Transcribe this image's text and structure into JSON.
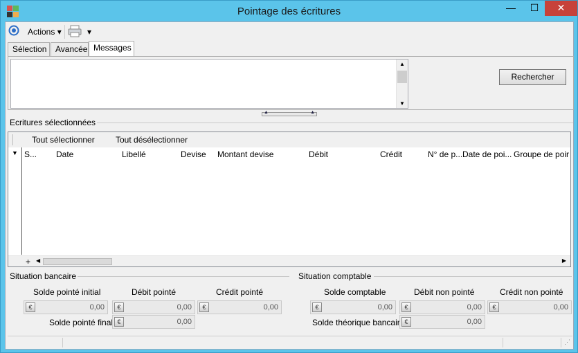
{
  "window": {
    "title": "Pointage des écritures",
    "minimize": "—",
    "maximize": "☐",
    "close": "✕"
  },
  "toolbar": {
    "actions_label": "Actions",
    "dropdown_arrow": "▾"
  },
  "tabs": [
    {
      "label": "Sélection"
    },
    {
      "label": "Avancée"
    },
    {
      "label": "Messages"
    }
  ],
  "search_button": "Rechercher",
  "grid": {
    "title": "Ecritures sélectionnées",
    "select_all": "Tout sélectionner",
    "deselect_all": "Tout désélectionner",
    "columns": [
      "S...",
      "Date",
      "Libellé",
      "Devise",
      "Montant devise",
      "Débit",
      "Crédit",
      "N° de p...",
      "Date de poi...",
      "Groupe de poir"
    ],
    "add_symbol": "+"
  },
  "situation_bancaire": {
    "title": "Situation bancaire",
    "solde_initial_label": "Solde pointé initial",
    "solde_initial_value": "0,00",
    "solde_final_label": "Solde pointé final",
    "debit_pointe_label": "Débit  pointé",
    "debit_pointe_value": "0,00",
    "solde_final_value": "0,00",
    "credit_pointe_label": "Crédit pointé",
    "credit_pointe_value": "0,00"
  },
  "situation_comptable": {
    "title": "Situation comptable",
    "solde_comptable_label": "Solde comptable",
    "solde_comptable_value": "0,00",
    "solde_theorique_label": "Solde théorique bancaire",
    "debit_non_pointe_label": "Débit non pointé",
    "debit_non_pointe_value": "0,00",
    "solde_theorique_value": "0,00",
    "credit_non_pointe_label": "Crédit non pointé",
    "credit_non_pointe_value": "0,00"
  },
  "currency_symbol": "€",
  "colors": {
    "titlebar": "#5bc4ea",
    "close": "#c7423a",
    "client": "#f0f0f0"
  }
}
